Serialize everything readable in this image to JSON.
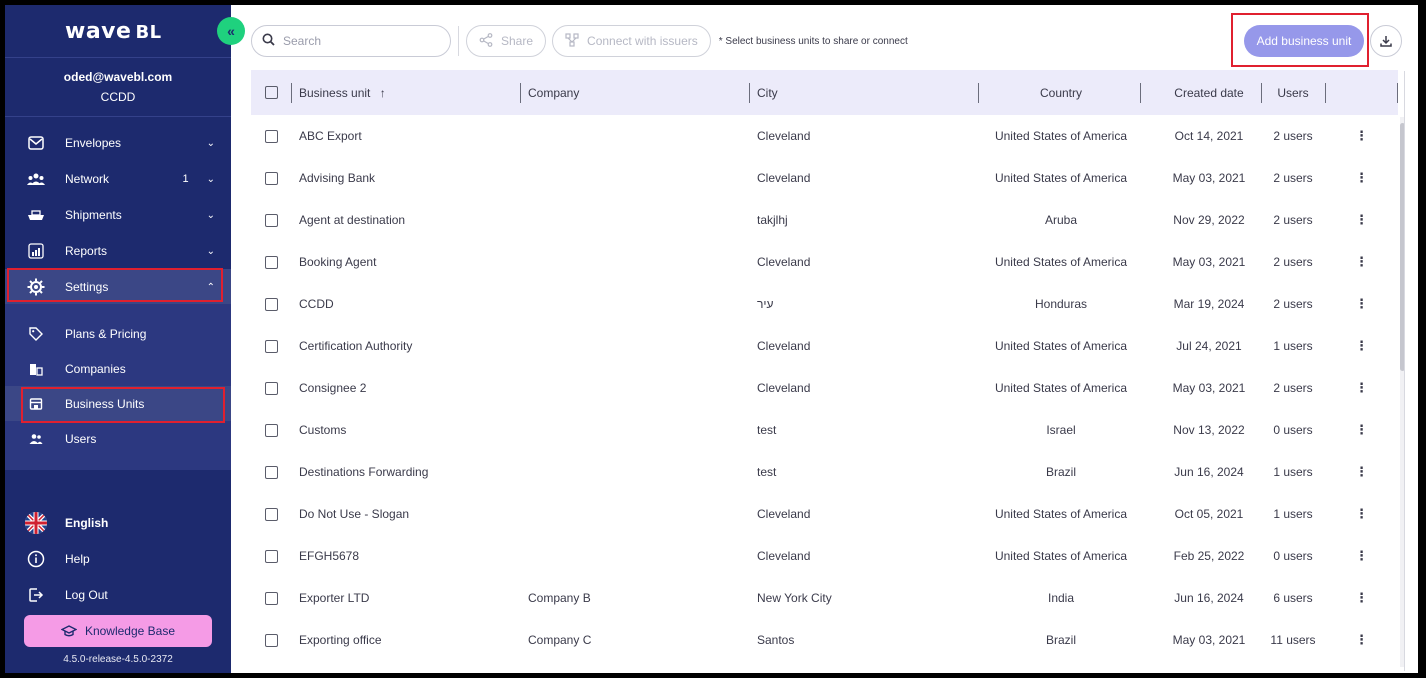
{
  "brand": {
    "logo_main": "wave",
    "logo_sub": "BL"
  },
  "collapse_icon": "«",
  "user": {
    "email": "oded@wavebl.com",
    "org": "CCDD"
  },
  "nav": [
    {
      "label": "Envelopes",
      "icon": "envelope-icon",
      "count": "",
      "chevron": "⌄"
    },
    {
      "label": "Network",
      "icon": "network-icon",
      "count": "1",
      "chevron": "⌄"
    },
    {
      "label": "Shipments",
      "icon": "ship-icon",
      "count": "",
      "chevron": "⌄"
    },
    {
      "label": "Reports",
      "icon": "reports-icon",
      "count": "",
      "chevron": "⌄"
    },
    {
      "label": "Settings",
      "icon": "gear-icon",
      "count": "",
      "chevron": "⌃"
    }
  ],
  "sub_nav": [
    {
      "label": "Plans & Pricing",
      "icon": "tag-icon"
    },
    {
      "label": "Companies",
      "icon": "building-icon"
    },
    {
      "label": "Business Units",
      "icon": "store-icon"
    },
    {
      "label": "Users",
      "icon": "users-icon"
    }
  ],
  "bottom_nav": {
    "language": "English",
    "help": "Help",
    "logout": "Log Out"
  },
  "knowledge_base": "Knowledge Base",
  "version": "4.5.0-release-4.5.0-2372",
  "toolbar": {
    "search_placeholder": "Search",
    "share_label": "Share",
    "connect_label": "Connect with issuers",
    "hint": "* Select business units to share or connect",
    "add_label": "Add business unit"
  },
  "table": {
    "headers": {
      "business_unit": "Business unit",
      "sort_indicator": "↑",
      "company": "Company",
      "city": "City",
      "country": "Country",
      "created": "Created date",
      "users": "Users"
    },
    "rows": [
      {
        "business_unit": "ABC Export",
        "company": "",
        "city": "Cleveland",
        "country": "United States of America",
        "created": "Oct 14, 2021",
        "users": "2 users"
      },
      {
        "business_unit": "Advising Bank",
        "company": "",
        "city": "Cleveland",
        "country": "United States of America",
        "created": "May 03, 2021",
        "users": "2 users"
      },
      {
        "business_unit": "Agent at destination",
        "company": "",
        "city": "takjlhj",
        "country": "Aruba",
        "created": "Nov 29, 2022",
        "users": "2 users"
      },
      {
        "business_unit": "Booking Agent",
        "company": "",
        "city": "Cleveland",
        "country": "United States of America",
        "created": "May 03, 2021",
        "users": "2 users"
      },
      {
        "business_unit": "CCDD",
        "company": "",
        "city": "עיר",
        "country": "Honduras",
        "created": "Mar 19, 2024",
        "users": "2 users"
      },
      {
        "business_unit": "Certification Authority",
        "company": "",
        "city": "Cleveland",
        "country": "United States of America",
        "created": "Jul 24, 2021",
        "users": "1 users"
      },
      {
        "business_unit": "Consignee 2",
        "company": "",
        "city": "Cleveland",
        "country": "United States of America",
        "created": "May 03, 2021",
        "users": "2 users"
      },
      {
        "business_unit": "Customs",
        "company": "",
        "city": "test",
        "country": "Israel",
        "created": "Nov 13, 2022",
        "users": "0 users"
      },
      {
        "business_unit": "Destinations Forwarding",
        "company": "",
        "city": "test",
        "country": "Brazil",
        "created": "Jun 16, 2024",
        "users": "1 users"
      },
      {
        "business_unit": "Do Not Use - Slogan",
        "company": "",
        "city": "Cleveland",
        "country": "United States of America",
        "created": "Oct 05, 2021",
        "users": "1 users"
      },
      {
        "business_unit": "EFGH5678",
        "company": "",
        "city": "Cleveland",
        "country": "United States of America",
        "created": "Feb 25, 2022",
        "users": "0 users"
      },
      {
        "business_unit": "Exporter LTD",
        "company": "Company B",
        "city": "New York City",
        "country": "India",
        "created": "Jun 16, 2024",
        "users": "6 users"
      },
      {
        "business_unit": "Exporting office",
        "company": "Company C",
        "city": "Santos",
        "country": "Brazil",
        "created": "May 03, 2021",
        "users": "11 users"
      }
    ]
  }
}
